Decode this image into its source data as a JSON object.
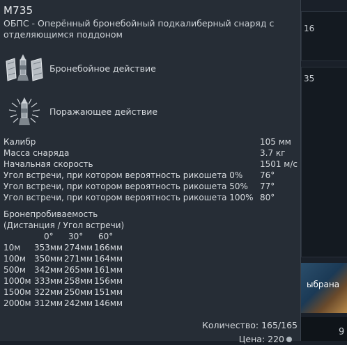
{
  "background": {
    "text_top": "16",
    "text_mid": "35",
    "tag_label": "ыбрана",
    "bottom_text": "9"
  },
  "tooltip": {
    "title": "M735",
    "description": "ОБПС - Оперённый бронебойный подкалиберный снаряд с отделяющимся поддоном",
    "effects": [
      {
        "icon": "armor-piercing-shell-icon",
        "label": "Бронебойное действие"
      },
      {
        "icon": "shrapnel-shell-icon",
        "label": "Поражающее действие"
      }
    ],
    "stats": [
      {
        "name": "Калибр",
        "value": "105 мм"
      },
      {
        "name": "Масса снаряда",
        "value": "3.7 кг"
      },
      {
        "name": "Начальная скорость",
        "value": "1501 м/с"
      },
      {
        "name": "Угол встречи, при котором вероятность рикошета 0%",
        "value": "76°"
      },
      {
        "name": "Угол встречи, при котором вероятность рикошета 50%",
        "value": "77°"
      },
      {
        "name": "Угол встречи, при котором вероятность рикошета 100%",
        "value": "80°"
      }
    ],
    "penetration": {
      "title": "Бронепробиваемость",
      "subtitle": "(Дистанция / Угол встречи)",
      "angles": [
        "0°",
        "30°",
        "60°"
      ],
      "rows": [
        {
          "distance": "10м",
          "values": [
            "353мм",
            "274мм",
            "166мм"
          ]
        },
        {
          "distance": "100м",
          "values": [
            "350мм",
            "271мм",
            "164мм"
          ]
        },
        {
          "distance": "500м",
          "values": [
            "342мм",
            "265мм",
            "161мм"
          ]
        },
        {
          "distance": "1000м",
          "values": [
            "333мм",
            "258мм",
            "156мм"
          ]
        },
        {
          "distance": "1500м",
          "values": [
            "322мм",
            "250мм",
            "151мм"
          ]
        },
        {
          "distance": "2000м",
          "values": [
            "312мм",
            "242мм",
            "146мм"
          ]
        }
      ]
    },
    "quantity": "Количество: 165/165",
    "price": "Цена: 220"
  }
}
